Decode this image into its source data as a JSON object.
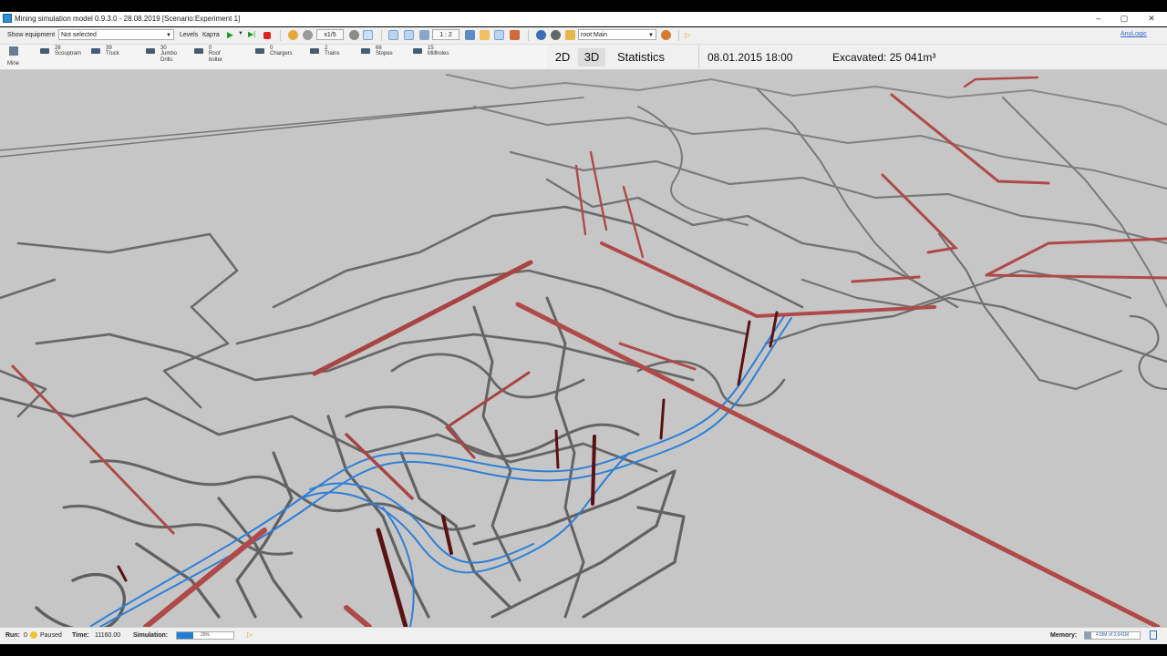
{
  "window": {
    "title": "Mining simulation model 0.9.3.0 - 28.08.2019 [Scenario:Experiment 1]",
    "controls": [
      "–",
      "▢",
      "✕"
    ]
  },
  "toolbar": {
    "show_equipment_label": "Show equipment",
    "equipment_select_value": "Not selected",
    "levels_label": "Levels",
    "levels_value": "Карта",
    "speed": "x1/5",
    "scale": "1 : 2",
    "agent_select_value": "root:Main",
    "brand": "AnyLogic"
  },
  "equipment": [
    {
      "count": "26",
      "name": "Scooptram",
      "name2": ""
    },
    {
      "count": "39",
      "name": "Truck",
      "name2": ""
    },
    {
      "count": "30",
      "name": "Jumbo",
      "name2": "Drills"
    },
    {
      "count": "0",
      "name": "Roof",
      "name2": "bolter"
    },
    {
      "count": "0",
      "name": "Chargers",
      "name2": ""
    },
    {
      "count": "2",
      "name": "Trains",
      "name2": ""
    },
    {
      "count": "66",
      "name": "Stopes",
      "name2": ""
    },
    {
      "count": "15",
      "name": "Millholes",
      "name2": ""
    }
  ],
  "mine_label": "Mine",
  "view": {
    "tabs": [
      "2D",
      "3D",
      "Statistics"
    ],
    "active_tab": "3D",
    "datetime": "08.01.2015 18:00",
    "excavated": "Excavated: 25 041m³"
  },
  "status": {
    "run_label": "Run:",
    "run_value": "0",
    "state": "Paused",
    "time_label": "Time:",
    "time_value": "11160.00",
    "simulation_label": "Simulation:",
    "simulation_progress": 0.29,
    "simulation_percent": "29%",
    "memory_label": "Memory:",
    "memory_value": "419M of 3,641M",
    "memory_fraction": 0.115
  },
  "colors": {
    "tunnel": "#6e6e6e",
    "active_tunnel": "#b04a4a",
    "rail": "#2f7fd8",
    "shaft": "#5a1212",
    "viewport_bg": "#c6c6c6"
  }
}
